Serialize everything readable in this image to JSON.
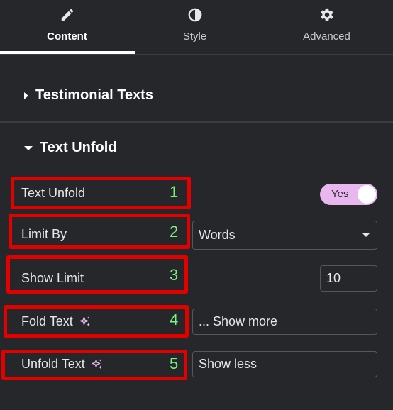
{
  "tabs": [
    {
      "label": "Content",
      "icon": "pencil-icon",
      "active": true
    },
    {
      "label": "Style",
      "icon": "half-circle-icon",
      "active": false
    },
    {
      "label": "Advanced",
      "icon": "gear-icon",
      "active": false
    }
  ],
  "sections": {
    "testimonial_texts": {
      "title": "Testimonial Texts",
      "expanded": false
    },
    "text_unfold": {
      "title": "Text Unfold",
      "expanded": true
    }
  },
  "controls": {
    "text_unfold": {
      "label": "Text Unfold",
      "number": "1",
      "toggle_text": "Yes",
      "enabled": true
    },
    "limit_by": {
      "label": "Limit By",
      "number": "2",
      "value": "Words"
    },
    "show_limit": {
      "label": "Show Limit",
      "number": "3",
      "value": "10"
    },
    "fold_text": {
      "label": "Fold Text",
      "number": "4",
      "value": "... Show more"
    },
    "unfold_text": {
      "label": "Unfold Text",
      "number": "5",
      "value": "Show less"
    }
  },
  "colors": {
    "background": "#26272b",
    "highlight": "#e50000",
    "number": "#7cf07c",
    "toggle": "#e9b6f0"
  }
}
